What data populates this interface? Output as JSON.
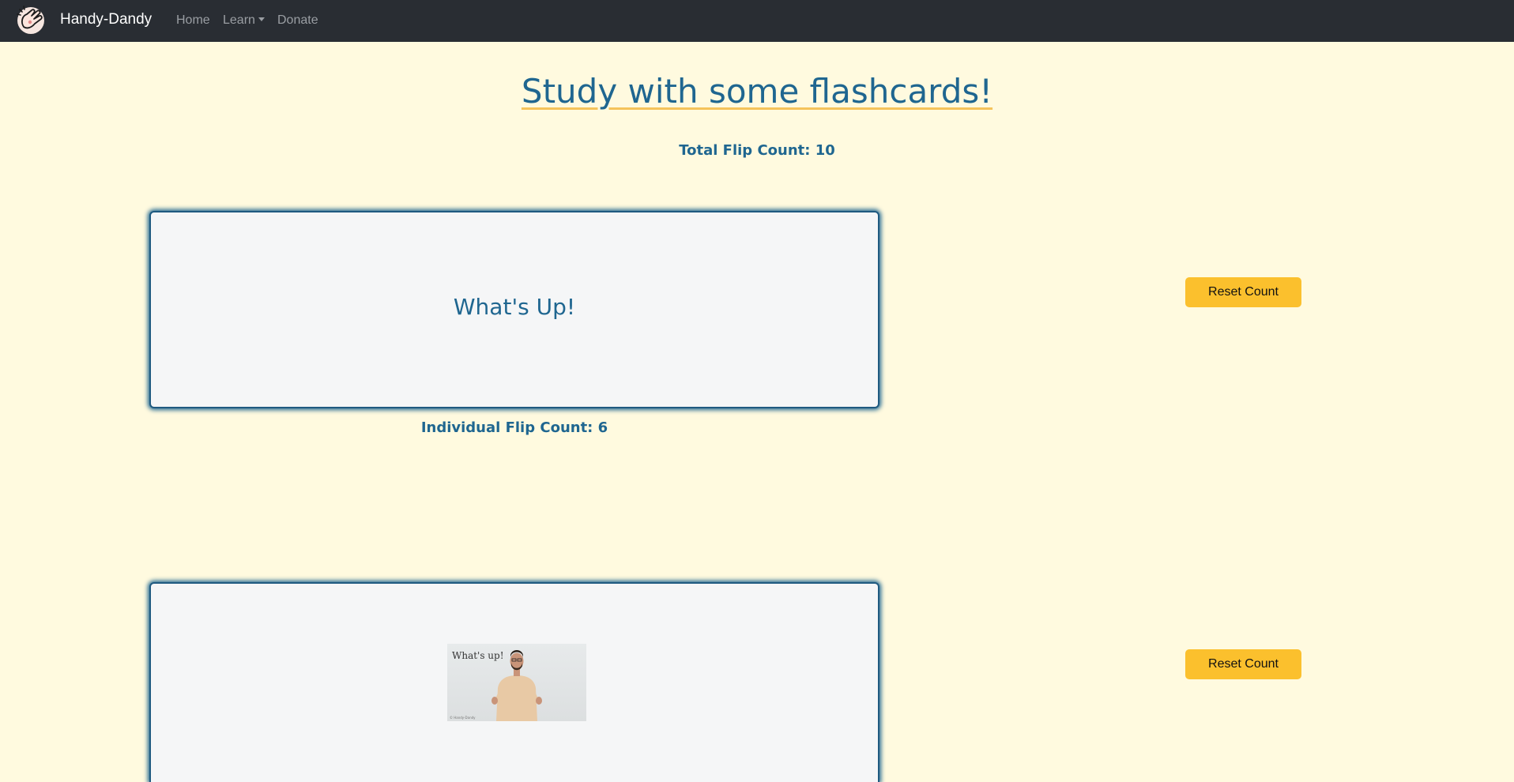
{
  "nav": {
    "brand": "Handy-Dandy",
    "links": [
      {
        "label": "Home"
      },
      {
        "label": "Learn"
      },
      {
        "label": "Donate"
      }
    ]
  },
  "main": {
    "title": "Study with some flashcards!",
    "total_flip_count": "Total Flip Count: 10"
  },
  "cards": [
    {
      "front_text": "What's Up!",
      "individual_flip_count": "Individual Flip Count: 6",
      "reset_label": "Reset Count"
    },
    {
      "image_caption": "What's up!",
      "image_credit": "© Handy-Dandy",
      "reset_label": "Reset Count"
    }
  ],
  "colors": {
    "navbar": "#292d33",
    "background": "#fffadf",
    "accent_blue": "#1f6690",
    "button_yellow": "#fbc02d",
    "underline_yellow": "#f5c35a"
  }
}
